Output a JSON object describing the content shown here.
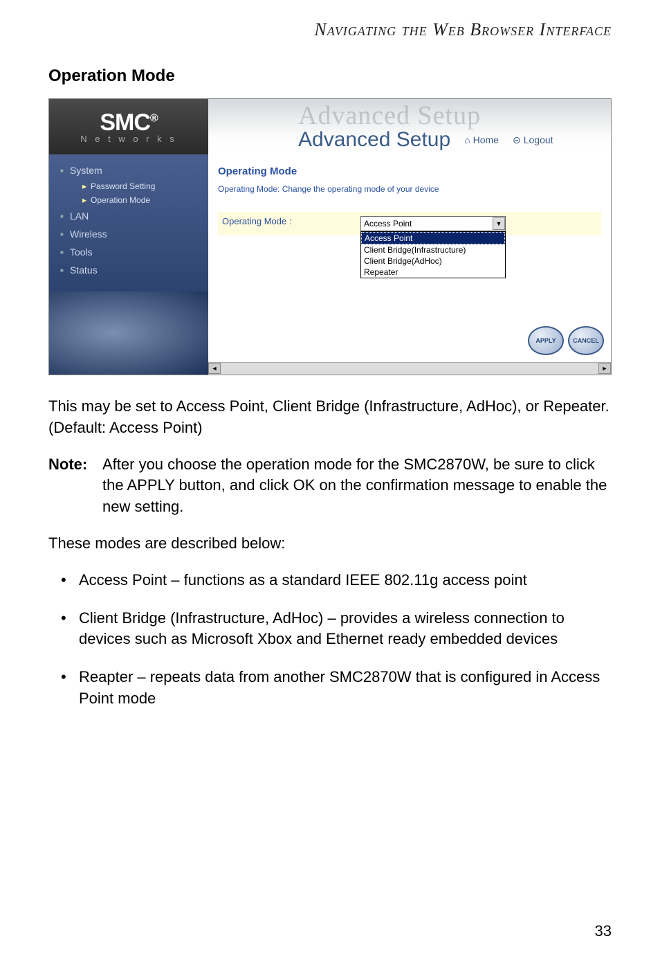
{
  "header": "Navigating the Web Browser Interface",
  "section_title": "Operation Mode",
  "app": {
    "logo_main": "SMC",
    "logo_reg": "®",
    "logo_sub": "N e t w o r k s",
    "watermark": "Advanced Setup",
    "banner_title": "Advanced Setup",
    "home": "Home",
    "logout": "Logout",
    "sidebar": {
      "system": "System",
      "password": "Password Setting",
      "opmode": "Operation Mode",
      "lan": "LAN",
      "wireless": "Wireless",
      "tools": "Tools",
      "status": "Status"
    },
    "panel": {
      "title": "Operating Mode",
      "desc": "Operating Mode: Change the operating mode of your device",
      "label": "Operating Mode :",
      "selected": "Access Point",
      "options": [
        "Access Point",
        "Client Bridge(Infrastructure)",
        "Client Bridge(AdHoc)",
        "Repeater"
      ],
      "apply": "APPLY",
      "cancel": "CANCEL"
    }
  },
  "para1": "This may be set to Access Point, Client Bridge (Infrastructure, AdHoc), or Repeater. (Default: Access Point)",
  "note_label": "Note:",
  "note_text": "After you choose the operation mode for the SMC2870W, be sure to click the APPLY button, and click OK on the confirmation message to enable the new setting.",
  "para2": "These modes are described below:",
  "bullets": [
    "Access Point – functions as a standard IEEE 802.11g access point",
    "Client Bridge (Infrastructure, AdHoc) – provides a wireless connection to devices such as Microsoft Xbox and Ethernet ready embedded devices",
    "Reapter – repeats data from another SMC2870W that is configured in Access Point mode"
  ],
  "page_num": "33"
}
